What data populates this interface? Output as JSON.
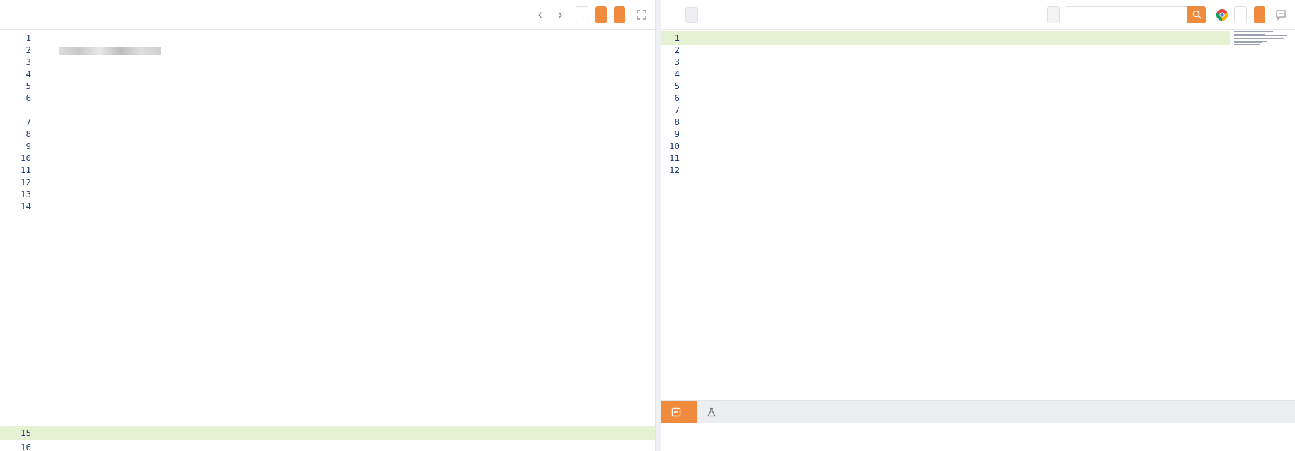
{
  "request": {
    "toolbar": {
      "title": "",
      "scan_label": "",
      "hot_load_label": "",
      "build_request_label": ""
    },
    "host_redacted_tail": "",
    "lines": {
      "l1": {
        "method": "",
        "path": "",
        "param_name": "",
        "eq": "",
        "param_value": "",
        "version": ""
      },
      "l2": {
        "name": "",
        "sep": ""
      },
      "l3": {
        "name": "",
        "sep": "",
        "value": ""
      },
      "l4": {
        "name": "",
        "sep": "",
        "value": ""
      },
      "l5": {
        "name": "",
        "sep": "",
        "value": ""
      },
      "l6": {
        "name": "",
        "sep": "",
        "value": ""
      },
      "l6b": {
        "value": ""
      },
      "l7": {
        "name": "",
        "sep": "",
        "value": ""
      },
      "l8": {
        "name": "",
        "sep": "",
        "value": ""
      },
      "l10": {
        "value": ""
      },
      "l11": {
        "name": "",
        "sep": "",
        "value": ""
      },
      "l12": {
        "name": "",
        "sep": "",
        "value": ""
      },
      "l14": {
        "tag": "",
        "open_paren": "",
        "wrapped": [
          "",
          "",
          "",
          "",
          "",
          "",
          "",
          "",
          "",
          "",
          "",
          "",
          ""
        ],
        "close": ""
      },
      "l15": {
        "value": ""
      }
    },
    "line_numbers": [
      "1",
      "2",
      "3",
      "4",
      "5",
      "6",
      "7",
      "8",
      "9",
      "10",
      "11",
      "12",
      "13",
      "14",
      "15",
      "16"
    ]
  },
  "response": {
    "toolbar": {
      "title": "",
      "size_info": "",
      "beautify_label": "",
      "search_placeholder": "",
      "view_extract_label": "",
      "detail_label": ""
    },
    "lines": {
      "l1": {
        "value": ""
      },
      "l2": {
        "name": "",
        "sep": "",
        "value": ""
      },
      "l3": {
        "name": "",
        "sep": "",
        "value": ""
      },
      "l4": {
        "name": "",
        "sep": "",
        "value": ""
      },
      "l5": {
        "name": "",
        "sep": "",
        "value": ""
      },
      "l6": {
        "name": "",
        "sep": "",
        "value": ""
      },
      "l7": {
        "name": "",
        "sep": "",
        "value": ""
      },
      "l8": {
        "name": "",
        "sep": "",
        "value": ""
      },
      "l9": {
        "name": "",
        "sep": "",
        "value": ""
      },
      "l10": {
        "name": "",
        "sep": "",
        "value": ""
      }
    },
    "line_numbers": [
      "1",
      "2",
      "3",
      "4",
      "5",
      "6",
      "7",
      "8",
      "9",
      "10",
      "11",
      "12"
    ],
    "tabs": {
      "payload_label": "",
      "extract_label": ""
    },
    "payload_preview": ""
  },
  "colors": {
    "accent": "#f08a3c",
    "header_name": "#1b5fcc",
    "highlight_row": "#e6f0d2"
  }
}
